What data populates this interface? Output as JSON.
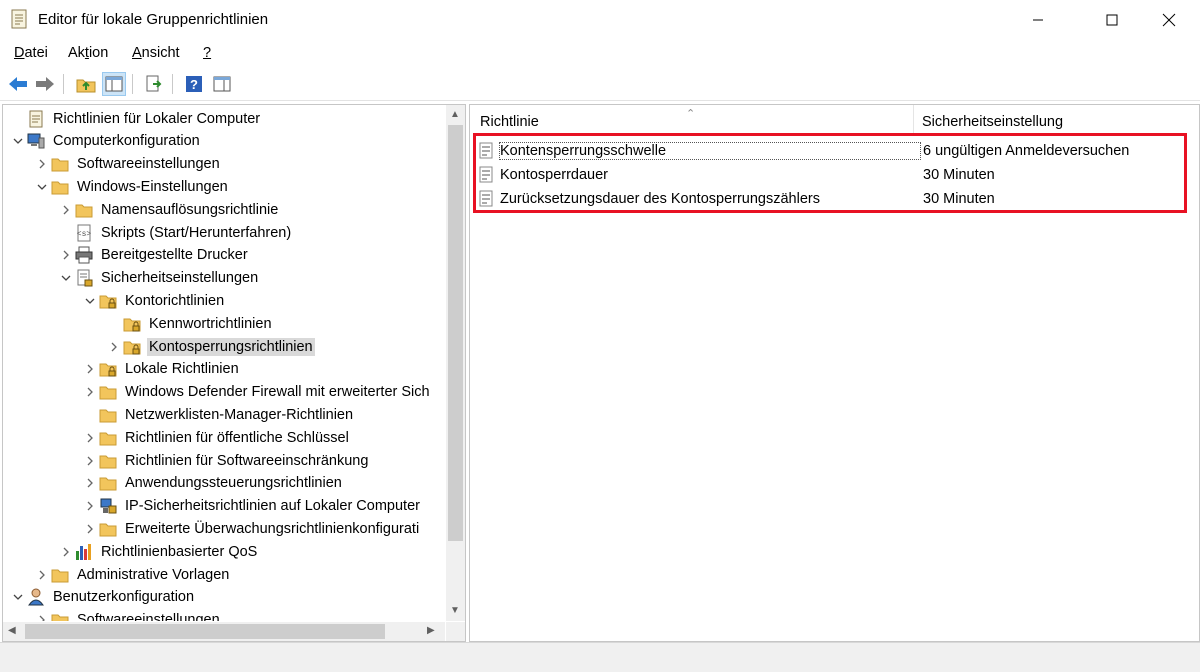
{
  "window": {
    "title": "Editor für lokale Gruppenrichtlinien",
    "minimize_icon": "minimize-icon",
    "maximize_icon": "maximize-icon",
    "close_icon": "close-icon"
  },
  "menu": {
    "items": [
      {
        "pre": "",
        "key": "D",
        "post": "atei"
      },
      {
        "pre": "Ak",
        "key": "t",
        "post": "ion"
      },
      {
        "pre": "",
        "key": "A",
        "post": "nsicht"
      },
      {
        "pre": "",
        "key": "?",
        "post": ""
      }
    ]
  },
  "toolbar": {
    "buttons": [
      "back-icon",
      "forward-icon",
      "up-folder-icon",
      "show-hide-tree-icon",
      "export-list-icon",
      "help-icon",
      "properties-icon"
    ]
  },
  "tree": {
    "items": [
      {
        "label": "Richtlinien für Lokaler Computer",
        "icon": "policy-doc-icon",
        "expander": "none"
      },
      {
        "label": "Computerkonfiguration",
        "icon": "computer-icon",
        "expander": "expanded"
      },
      {
        "label": "Softwareeinstellungen",
        "icon": "folder-icon",
        "expander": "collapsed"
      },
      {
        "label": "Windows-Einstellungen",
        "icon": "folder-icon",
        "expander": "expanded"
      },
      {
        "label": "Namensauflösungsrichtlinie",
        "icon": "folder-icon",
        "expander": "collapsed"
      },
      {
        "label": "Skripts (Start/Herunterfahren)",
        "icon": "script-icon",
        "expander": "none"
      },
      {
        "label": "Bereitgestellte Drucker",
        "icon": "printer-icon",
        "expander": "collapsed"
      },
      {
        "label": "Sicherheitseinstellungen",
        "icon": "security-settings-icon",
        "expander": "expanded"
      },
      {
        "label": "Kontorichtlinien",
        "icon": "folder-lock-icon",
        "expander": "expanded"
      },
      {
        "label": "Kennwortrichtlinien",
        "icon": "folder-lock-icon",
        "expander": "none"
      },
      {
        "label": "Kontosperrungsrichtlinien",
        "icon": "folder-lock-icon",
        "expander": "collapsed",
        "selected": true
      },
      {
        "label": "Lokale Richtlinien",
        "icon": "folder-lock-icon",
        "expander": "collapsed"
      },
      {
        "label": "Windows Defender Firewall mit erweiterter Sich",
        "icon": "folder-icon",
        "expander": "collapsed"
      },
      {
        "label": "Netzwerklisten-Manager-Richtlinien",
        "icon": "folder-icon",
        "expander": "none"
      },
      {
        "label": "Richtlinien für öffentliche Schlüssel",
        "icon": "folder-icon",
        "expander": "collapsed"
      },
      {
        "label": "Richtlinien für Softwareeinschränkung",
        "icon": "folder-icon",
        "expander": "collapsed"
      },
      {
        "label": "Anwendungssteuerungsrichtlinien",
        "icon": "folder-icon",
        "expander": "collapsed"
      },
      {
        "label": "IP-Sicherheitsrichtlinien auf Lokaler Computer",
        "icon": "ip-security-icon",
        "expander": "collapsed"
      },
      {
        "label": "Erweiterte Überwachungsrichtlinienkonfigurati",
        "icon": "folder-icon",
        "expander": "collapsed"
      },
      {
        "label": "Richtlinienbasierter QoS",
        "icon": "qos-chart-icon",
        "expander": "collapsed"
      },
      {
        "label": "Administrative Vorlagen",
        "icon": "folder-icon",
        "expander": "collapsed"
      },
      {
        "label": "Benutzerkonfiguration",
        "icon": "user-icon",
        "expander": "expanded"
      },
      {
        "label": "Softwareeinstellungen",
        "icon": "folder-icon",
        "expander": "collapsed"
      }
    ]
  },
  "list": {
    "columns": [
      "Richtlinie",
      "Sicherheitseinstellung"
    ],
    "rows": [
      {
        "policy": "Kontensperrungsschwelle",
        "setting": "6 ungültigen Anmeldeversuchen"
      },
      {
        "policy": "Kontosperrdauer",
        "setting": "30 Minuten"
      },
      {
        "policy": "Zurücksetzungsdauer des Kontosperrungszählers",
        "setting": "30 Minuten"
      }
    ]
  },
  "colors": {
    "highlight": "#e81123",
    "selection": "#d9d9d9",
    "folder": "#f2c55c"
  }
}
